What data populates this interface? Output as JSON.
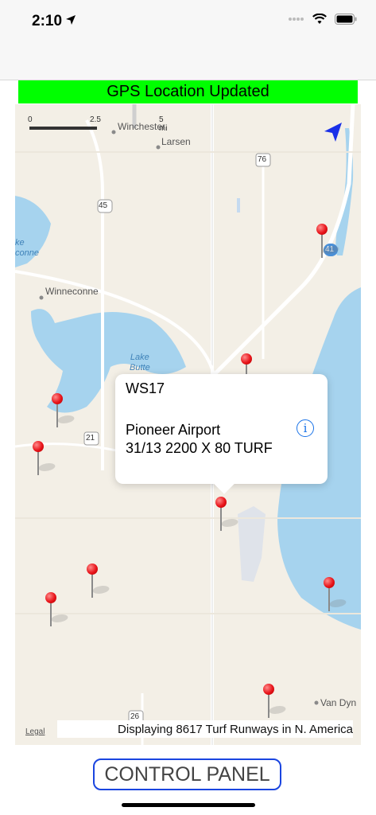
{
  "status": {
    "time": "2:10"
  },
  "banner": {
    "gps_text": "GPS Location Updated"
  },
  "map": {
    "scale": {
      "zero": "0",
      "mid": "2.5",
      "end": "5 mi"
    },
    "places": {
      "winchester": "Winchester",
      "larsen": "Larsen",
      "winneconne": "Winneconne",
      "van_dyne": "Van Dyn"
    },
    "lakes": {
      "butte_line1": "Lake",
      "butte_line2": "Butte",
      "west_lake": "ke\nconne"
    },
    "routes": {
      "us45": "45",
      "r76": "76",
      "r41": "41",
      "r21": "21",
      "r26": "26"
    },
    "legal": "Legal",
    "count_text": "Displaying 8617 Turf Runways in N. America"
  },
  "callout": {
    "ident": "WS17",
    "name": "Pioneer Airport",
    "runway": "31/13 2200 X 80 TURF",
    "info_glyph": "i"
  },
  "control_panel": {
    "label": "CONTROL PANEL"
  },
  "colors": {
    "gps_banner": "#00ff00",
    "pin": "#e8141a",
    "button_border": "#1a45e0",
    "water": "#a6d3ee"
  }
}
